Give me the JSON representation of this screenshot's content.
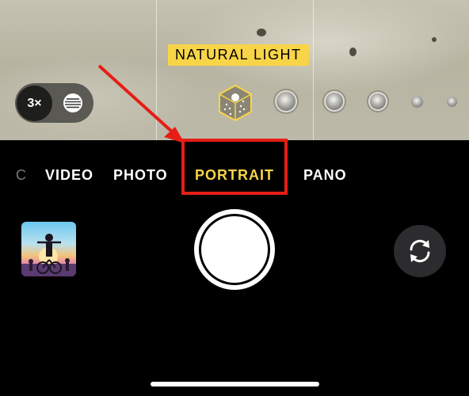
{
  "lighting": {
    "label": "NATURAL LIGHT"
  },
  "zoom": {
    "label": "3×"
  },
  "modes": {
    "cut": "C",
    "video": "VIDEO",
    "photo": "PHOTO",
    "portrait": "PORTRAIT",
    "pano": "PANO",
    "selected": "PORTRAIT"
  },
  "colors": {
    "accent": "#f8d548",
    "annotation": "#e51e16"
  },
  "icons": {
    "depth": "aperture-depth-icon",
    "lighting": "natural-light-cube-icon",
    "flip": "camera-flip-icon"
  }
}
